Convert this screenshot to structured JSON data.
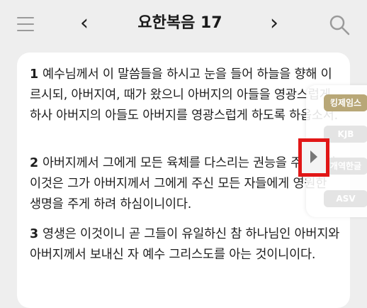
{
  "header": {
    "title": "요한복음 17",
    "prev": "‹",
    "next": "›"
  },
  "verses": [
    {
      "num": "1",
      "text": "예수님께서 이 말씀들을 하시고 눈을 들어 하늘을 향해 이르시되, 아버지여, 때가 왔으니 아버지의 아들을 영광스럽게 하사 아버지의 아들도 아버지를 영광스럽게 하도록 하옵소서."
    },
    {
      "num": "2",
      "text": "아버지께서 그에게 모든 육체를 다스리는 권능을 주셨으니 이것은 그가 아버지께서 그에게 주신 모든 자들에게 영원한 생명을 주게 하려 하심이니이다."
    },
    {
      "num": "3",
      "text": "영생은 이것이니 곧 그들이 유일하신 참 하나님인 아버지와 아버지께서 보내신 자 예수 그리스도를 아는 것이니이다."
    }
  ],
  "versions": [
    {
      "label": "킹제임스",
      "active": true
    },
    {
      "label": "KJB",
      "active": false
    },
    {
      "label": "개역한글",
      "active": false
    },
    {
      "label": "ASV",
      "active": false
    }
  ],
  "colors": {
    "accent": "#b8a777",
    "highlight": "#e11717"
  }
}
